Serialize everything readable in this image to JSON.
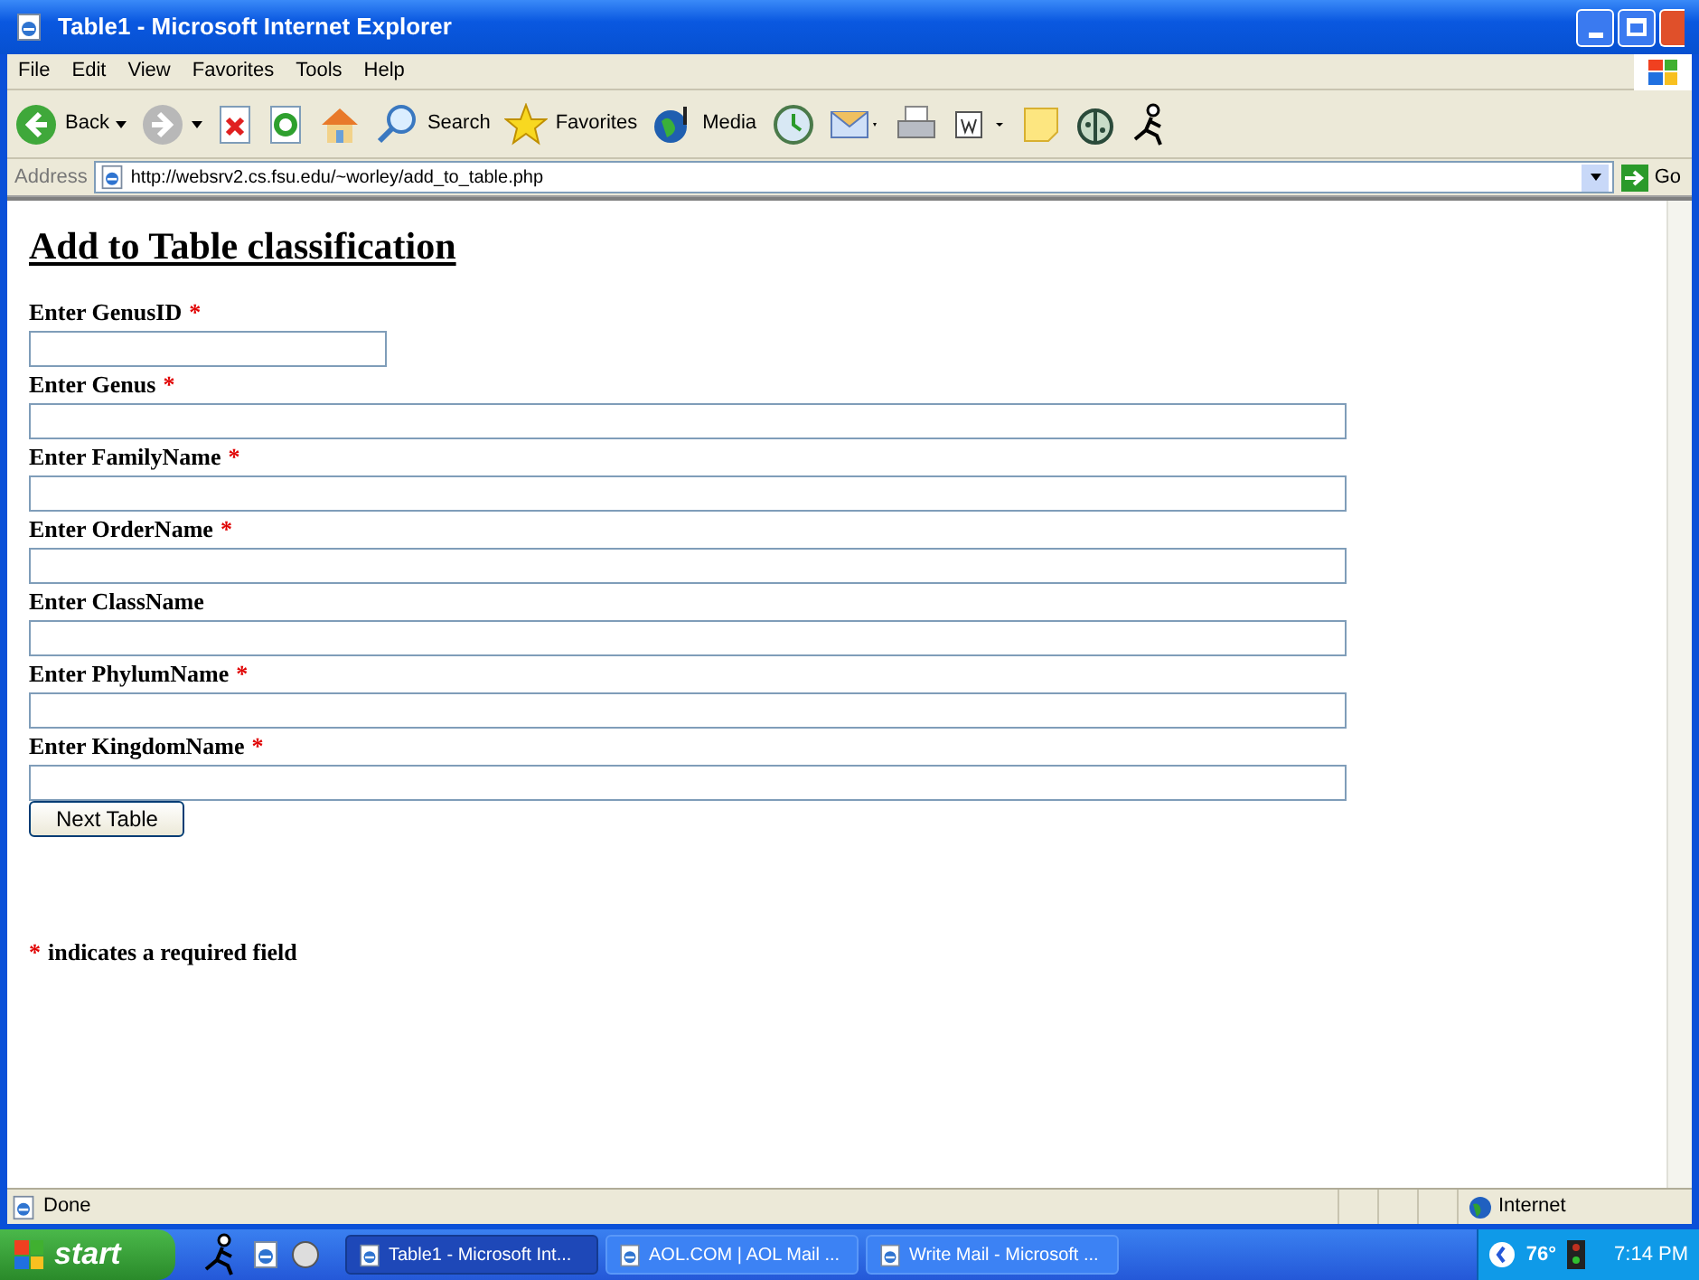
{
  "window": {
    "title": "Table1 - Microsoft Internet Explorer"
  },
  "menu": [
    "File",
    "Edit",
    "View",
    "Favorites",
    "Tools",
    "Help"
  ],
  "toolbar": [
    {
      "kind": "back",
      "label": "Back"
    },
    {
      "kind": "forward"
    },
    {
      "kind": "stop"
    },
    {
      "kind": "refresh"
    },
    {
      "kind": "home"
    },
    {
      "kind": "search",
      "label": "Search"
    },
    {
      "kind": "favorites",
      "label": "Favorites"
    },
    {
      "kind": "media",
      "label": "Media"
    },
    {
      "kind": "history"
    },
    {
      "kind": "mail"
    },
    {
      "kind": "print"
    },
    {
      "kind": "edit"
    },
    {
      "kind": "note"
    },
    {
      "kind": "bug"
    },
    {
      "kind": "runner"
    }
  ],
  "address": {
    "label": "Address",
    "url": "http://websrv2.cs.fsu.edu/~worley/add_to_table.php",
    "go": "Go"
  },
  "page": {
    "heading": "Add to Table classification",
    "fields": [
      {
        "label": "Enter GenusID",
        "mark": "*",
        "kind": "short"
      },
      {
        "label": "Enter Genus",
        "mark": "*",
        "kind": "long"
      },
      {
        "label": "Enter FamilyName",
        "mark": "*",
        "kind": "long"
      },
      {
        "label": "Enter OrderName",
        "mark": "*",
        "kind": "long"
      },
      {
        "label": "Enter ClassName",
        "kind": "long"
      },
      {
        "label": "Enter PhylumName",
        "mark": "*",
        "kind": "long"
      },
      {
        "label": "Enter KingdomName",
        "mark": "*",
        "kind": "long"
      }
    ],
    "button": "Next Table",
    "note": {
      "mark": "*",
      "text": "indicates a required field"
    }
  },
  "status_bar": {
    "text": "Done",
    "zone": "Internet"
  },
  "taskbar": {
    "start": "start",
    "tasks": [
      {
        "label": "Table1 - Microsoft Int...",
        "selected": true
      },
      {
        "label": "AOL.COM | AOL Mail ...",
        "selected": false
      },
      {
        "label": "Write Mail - Microsoft ...",
        "selected": false
      }
    ],
    "temperature": "76°",
    "time": "7:14 PM"
  }
}
